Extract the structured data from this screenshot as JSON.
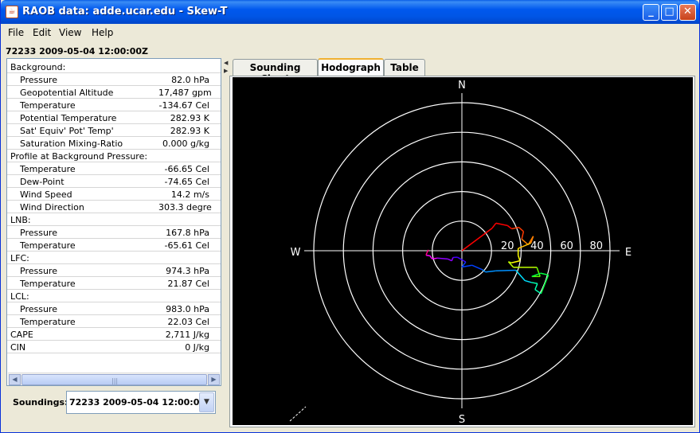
{
  "window": {
    "title": "RAOB data: adde.ucar.edu - Skew-T",
    "app_icon": "java-cup-icon"
  },
  "menu": [
    "File",
    "Edit",
    "View",
    "Help"
  ],
  "header": "72233 2009-05-04 12:00:00Z",
  "properties": [
    {
      "label": "Background:",
      "value": "",
      "sub": false
    },
    {
      "label": "Pressure",
      "value": "82.0 hPa",
      "sub": true
    },
    {
      "label": "Geopotential Altitude",
      "value": "17,487 gpm",
      "sub": true
    },
    {
      "label": "Temperature",
      "value": "-134.67 Cel",
      "sub": true
    },
    {
      "label": "Potential Temperature",
      "value": "282.93 K",
      "sub": true
    },
    {
      "label": "Sat' Equiv' Pot' Temp'",
      "value": "282.93 K",
      "sub": true
    },
    {
      "label": "Saturation Mixing-Ratio",
      "value": "0.000 g/kg",
      "sub": true
    },
    {
      "label": "Profile at Background Pressure:",
      "value": "",
      "sub": false
    },
    {
      "label": "Temperature",
      "value": "-66.65 Cel",
      "sub": true
    },
    {
      "label": "Dew-Point",
      "value": "-74.65 Cel",
      "sub": true
    },
    {
      "label": "Wind Speed",
      "value": "14.2 m/s",
      "sub": true
    },
    {
      "label": "Wind Direction",
      "value": "303.3 degre",
      "sub": true
    },
    {
      "label": "LNB:",
      "value": "",
      "sub": false
    },
    {
      "label": "Pressure",
      "value": "167.8 hPa",
      "sub": true
    },
    {
      "label": "Temperature",
      "value": "-65.61 Cel",
      "sub": true
    },
    {
      "label": "LFC:",
      "value": "",
      "sub": false
    },
    {
      "label": "Pressure",
      "value": "974.3 hPa",
      "sub": true
    },
    {
      "label": "Temperature",
      "value": "21.87 Cel",
      "sub": true
    },
    {
      "label": "LCL:",
      "value": "",
      "sub": false
    },
    {
      "label": "Pressure",
      "value": "983.0 hPa",
      "sub": true
    },
    {
      "label": "Temperature",
      "value": "22.03 Cel",
      "sub": true
    },
    {
      "label": "CAPE",
      "value": "2,711 J/kg",
      "sub": false
    },
    {
      "label": "CIN",
      "value": "0 J/kg",
      "sub": false
    }
  ],
  "soundings": {
    "label": "Soundings:",
    "selected": "72233 2009-05-04 12:00:00Z"
  },
  "tabs": [
    {
      "label": "Sounding Chart",
      "active": false
    },
    {
      "label": "Hodograph",
      "active": true
    },
    {
      "label": "Table",
      "active": false
    }
  ],
  "hodograph": {
    "compass": {
      "n": "N",
      "s": "S",
      "e": "E",
      "w": "W"
    },
    "ring_labels": [
      "20",
      "40",
      "60",
      "80"
    ],
    "ring_speeds": [
      10,
      20,
      30,
      40,
      50
    ],
    "units_per_ring_label": 20,
    "trace_uv": [
      [
        10.2,
        7.6
      ],
      [
        11.5,
        9.3
      ],
      [
        15.4,
        8.5
      ],
      [
        16.8,
        7.4
      ],
      [
        19.2,
        7.9
      ],
      [
        20.8,
        6.5
      ],
      [
        20.2,
        3.9
      ],
      [
        22.4,
        2.0
      ],
      [
        24.1,
        4.9
      ],
      [
        23.3,
        2.6
      ],
      [
        21.0,
        1.6
      ],
      [
        19.0,
        0.8
      ],
      [
        19.0,
        -1.6
      ],
      [
        19.6,
        -3.4
      ],
      [
        16.7,
        -4.1
      ],
      [
        15.7,
        -3.7
      ],
      [
        17.4,
        -5.6
      ],
      [
        25.3,
        -5.6
      ],
      [
        26.4,
        -8.7
      ],
      [
        23.6,
        -8.7
      ],
      [
        26.6,
        -7.6
      ],
      [
        29.2,
        -8.2
      ],
      [
        26.7,
        -14.5
      ],
      [
        24.7,
        -13.1
      ],
      [
        25.5,
        -11.1
      ],
      [
        23.4,
        -10.7
      ],
      [
        21.3,
        -10.1
      ],
      [
        18.2,
        -6.6
      ],
      [
        11.5,
        -6.8
      ],
      [
        8.0,
        -7.2
      ],
      [
        6.9,
        -6.4
      ],
      [
        3.4,
        -4.9
      ],
      [
        0.0,
        -5.5
      ],
      [
        1.3,
        -3.8
      ],
      [
        -1.5,
        -2.2
      ],
      [
        -3.0,
        -2.3
      ],
      [
        -3.4,
        -3.4
      ],
      [
        -4.7,
        -2.8
      ],
      [
        -8.4,
        -2.5
      ],
      [
        -10.0,
        -2.8
      ],
      [
        -10.8,
        -1.7
      ],
      [
        -12.1,
        -1.5
      ],
      [
        -11.8,
        -0.7
      ],
      [
        -11.3,
        0.3
      ]
    ],
    "trace_colors": [
      "#ff0000",
      "#ff3a00",
      "#ff8000",
      "#ffc000",
      "#ffff00",
      "#c0ff00",
      "#60ff00",
      "#00ff40",
      "#00ffb0",
      "#00e0ff",
      "#0090ff",
      "#0040ff",
      "#4000ff",
      "#9000ff",
      "#ff00ff",
      "#ff0080"
    ]
  }
}
